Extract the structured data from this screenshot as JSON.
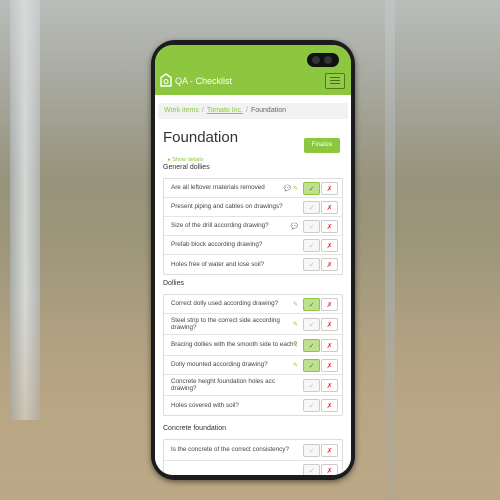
{
  "app": {
    "title": "QA - Checklist"
  },
  "breadcrumb": {
    "items": [
      "Work items",
      "Tomato Inc.",
      "Foundation"
    ]
  },
  "page": {
    "title": "Foundation",
    "finalize_label": "Finalize",
    "show_details_label": "▸ Show details"
  },
  "accent": "#8dc63f",
  "sections": [
    {
      "title": "General dollies",
      "items": [
        {
          "text": "Are all leftover materials removed",
          "comment": true,
          "attach": true,
          "ok": true
        },
        {
          "text": "Present piping and cables on drawings?",
          "comment": false,
          "attach": false,
          "ok": false
        },
        {
          "text": "Size of the drill according drawing?",
          "comment": true,
          "attach": false,
          "ok": false
        },
        {
          "text": "Prefab block according drawing?",
          "comment": false,
          "attach": false,
          "ok": false
        },
        {
          "text": "Holes free of water and lose soil?",
          "comment": false,
          "attach": false,
          "ok": false
        }
      ]
    },
    {
      "title": "Dollies",
      "items": [
        {
          "text": "Correct dolly used according drawing?",
          "comment": false,
          "attach": true,
          "ok": true
        },
        {
          "text": "Steel strip to the correct side according drawing?",
          "comment": false,
          "attach": true,
          "ok": false
        },
        {
          "text": "Bracing dollies with the smooth side to each?",
          "comment": false,
          "attach": true,
          "ok": true
        },
        {
          "text": "Dolly mounted according drawing?",
          "comment": false,
          "attach": true,
          "ok": true
        },
        {
          "text": "Concrete height foundation holes acc drawing?",
          "comment": false,
          "attach": false,
          "ok": false
        },
        {
          "text": "Holes covered with soil?",
          "comment": false,
          "attach": false,
          "ok": false
        }
      ]
    },
    {
      "title": "Concrete foundation",
      "items": [
        {
          "text": "Is the concrete of the correct consistency?",
          "comment": false,
          "attach": false,
          "ok": false
        },
        {
          "text": "",
          "comment": false,
          "attach": false,
          "ok": false
        }
      ]
    }
  ],
  "icons": {
    "check": "✓",
    "cross": "✗",
    "comment": "💬",
    "attach": "✎"
  }
}
